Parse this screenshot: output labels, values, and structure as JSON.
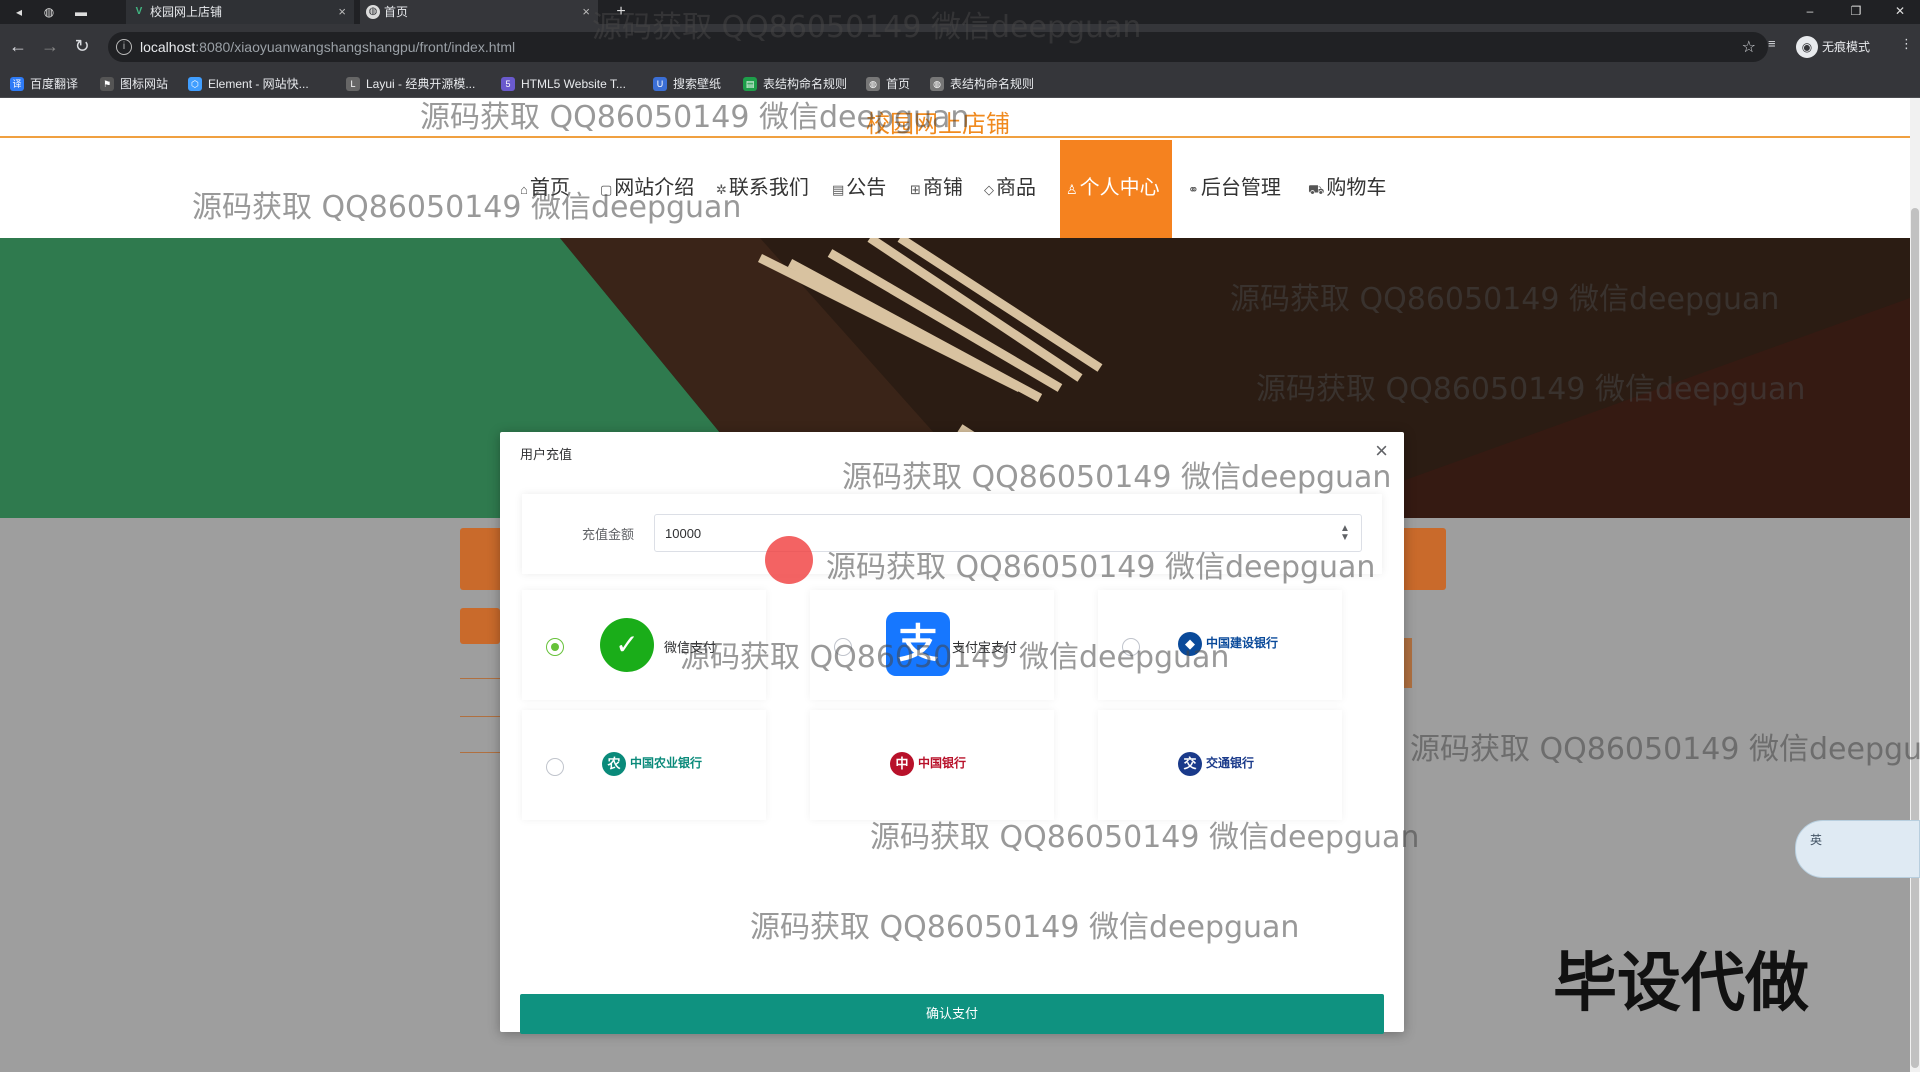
{
  "browser": {
    "tabs": [
      {
        "title": "校园网上店铺",
        "favicon": "vue-icon"
      },
      {
        "title": "首页",
        "favicon": "globe-icon"
      }
    ],
    "url_host": "localhost",
    "url_path": ":8080/xiaoyuanwangshangshangpu/front/index.html",
    "incognito_label": "无痕模式",
    "bookmarks": [
      {
        "label": "百度翻译",
        "icon": "translate-icon",
        "color": "#2e7bf6"
      },
      {
        "label": "图标网站",
        "icon": "flag-icon",
        "color": "#555555"
      },
      {
        "label": "Element - 网站快...",
        "icon": "element-icon",
        "color": "#409eff"
      },
      {
        "label": "Layui - 经典开源模...",
        "icon": "layui-icon",
        "color": "#666666"
      },
      {
        "label": "HTML5 Website T...",
        "icon": "html5-icon",
        "color": "#6a5acd"
      },
      {
        "label": "搜索壁纸",
        "icon": "wallpaper-icon",
        "color": "#3b6fd6"
      },
      {
        "label": "表结构命名规则",
        "icon": "sheet-icon",
        "color": "#1e9e4a"
      },
      {
        "label": "首页",
        "icon": "globe-icon",
        "color": "#777777"
      },
      {
        "label": "表结构命名规则",
        "icon": "globe-icon",
        "color": "#777777"
      }
    ]
  },
  "site": {
    "title": "校园网上店铺",
    "nav": [
      {
        "label": "首页",
        "icon": "home-icon",
        "active": false
      },
      {
        "label": "网站介绍",
        "icon": "doc-icon",
        "active": false
      },
      {
        "label": "联系我们",
        "icon": "gear-icon",
        "active": false
      },
      {
        "label": "公告",
        "icon": "notice-icon",
        "active": false
      },
      {
        "label": "商铺",
        "icon": "shop-icon",
        "active": false
      },
      {
        "label": "商品",
        "icon": "tag-icon",
        "active": false
      },
      {
        "label": "个人中心",
        "icon": "user-icon",
        "active": true
      },
      {
        "label": "后台管理",
        "icon": "link-icon",
        "active": false
      },
      {
        "label": "购物车",
        "icon": "cart-icon",
        "active": false
      }
    ],
    "accent": "#f5821f"
  },
  "dialog": {
    "title": "用户充值",
    "amount_label": "充值金额",
    "amount_value": "10000",
    "payments": [
      {
        "name": "微信支付",
        "logo": "wechat-pay-icon",
        "color": "#1aad19",
        "checked": true
      },
      {
        "name": "支付宝支付",
        "logo": "alipay-icon",
        "color": "#1677ff",
        "checked": false
      },
      {
        "name": "中国建设银行",
        "logo": "ccb-icon",
        "color": "#0a4a9a",
        "checked": false
      },
      {
        "name": "中国农业银行",
        "logo": "abc-icon",
        "color": "#0a8a7a",
        "checked": false
      },
      {
        "name": "中国银行",
        "logo": "boc-icon",
        "color": "#b8112a",
        "checked": false
      },
      {
        "name": "交通银行",
        "logo": "bocom-icon",
        "color": "#1a3a8a",
        "checked": false
      }
    ],
    "confirm_label": "确认支付",
    "confirm_color": "#0f9280"
  },
  "ime": {
    "label": "英"
  },
  "watermark": "源码获取 QQ86050149 微信deepguan",
  "overlay_text": "毕设代做"
}
